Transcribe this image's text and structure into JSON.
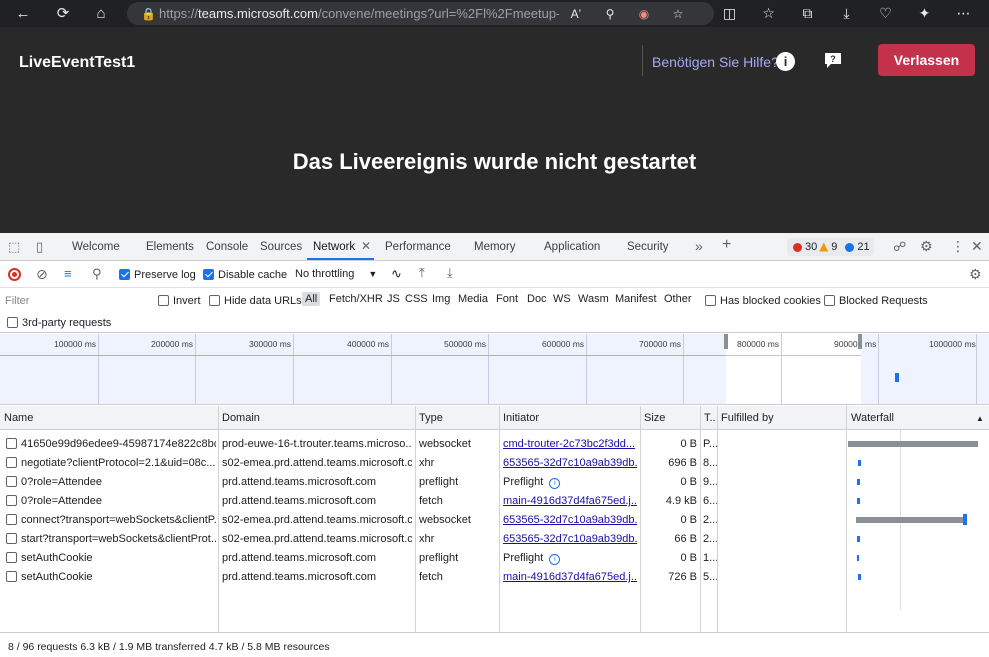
{
  "browser": {
    "url_prefix": "https://",
    "url_host": "teams.microsoft.com",
    "url_path": "/convene/meetings?url=%2Fl%2Fmeetup-j..."
  },
  "teams": {
    "event_title": "LiveEventTest1",
    "help_text": "Benötigen Sie Hilfe?",
    "leave_label": "Verlassen",
    "headline": "Das Liveereignis wurde nicht gestartet"
  },
  "devtools": {
    "tabs": [
      "Welcome",
      "Elements",
      "Console",
      "Sources",
      "Network",
      "Performance",
      "Memory",
      "Application",
      "Security"
    ],
    "active_tab": "Network",
    "errors": "30",
    "warnings": "9",
    "messages": "21",
    "preserve_log": "Preserve log",
    "disable_cache": "Disable cache",
    "throttling": "No throttling",
    "filter_placeholder": "Filter",
    "invert": "Invert",
    "hide_data_urls": "Hide data URLs",
    "types": [
      "All",
      "Fetch/XHR",
      "JS",
      "CSS",
      "Img",
      "Media",
      "Font",
      "Doc",
      "WS",
      "Wasm",
      "Manifest",
      "Other"
    ],
    "has_blocked_cookies": "Has blocked cookies",
    "blocked_requests": "Blocked Requests",
    "third_party": "3rd-party requests",
    "overview_ticks": [
      "100000 ms",
      "200000 ms",
      "300000 ms",
      "400000 ms",
      "500000 ms",
      "600000 ms",
      "700000 ms",
      "800000 ms",
      "90000",
      "ms",
      "1000000 ms"
    ],
    "columns": [
      "Name",
      "Domain",
      "Type",
      "Initiator",
      "Size",
      "T..",
      "Fulfilled by",
      "Waterfall"
    ],
    "rows": [
      {
        "name": "41650e99d96edee9-45987174e822c8bc...",
        "domain": "prod-euwe-16-t.trouter.teams.microso...",
        "type": "websocket",
        "initiator": "cmd-trouter-2c73bc2f3dd...",
        "initiator_link": true,
        "size": "0 B",
        "time": "P..."
      },
      {
        "name": "negotiate?clientProtocol=2.1&uid=08c...",
        "domain": "s02-emea.prd.attend.teams.microsoft.c...",
        "type": "xhr",
        "initiator": "653565-32d7c10a9ab39db...",
        "initiator_link": true,
        "size": "696 B",
        "time": "8..."
      },
      {
        "name": "0?role=Attendee",
        "domain": "prd.attend.teams.microsoft.com",
        "type": "preflight",
        "initiator": "Preflight",
        "initiator_link": false,
        "size": "0 B",
        "time": "9..."
      },
      {
        "name": "0?role=Attendee",
        "domain": "prd.attend.teams.microsoft.com",
        "type": "fetch",
        "initiator": "main-4916d37d4fa675ed.j...",
        "initiator_link": true,
        "size": "4.9 kB",
        "time": "6..."
      },
      {
        "name": "connect?transport=webSockets&clientP...",
        "domain": "s02-emea.prd.attend.teams.microsoft.c...",
        "type": "websocket",
        "initiator": "653565-32d7c10a9ab39db...",
        "initiator_link": true,
        "size": "0 B",
        "time": "2..."
      },
      {
        "name": "start?transport=webSockets&clientProt...",
        "domain": "s02-emea.prd.attend.teams.microsoft.c...",
        "type": "xhr",
        "initiator": "653565-32d7c10a9ab39db...",
        "initiator_link": true,
        "size": "66 B",
        "time": "2..."
      },
      {
        "name": "setAuthCookie",
        "domain": "prd.attend.teams.microsoft.com",
        "type": "preflight",
        "initiator": "Preflight",
        "initiator_link": false,
        "size": "0 B",
        "time": "1..."
      },
      {
        "name": "setAuthCookie",
        "domain": "prd.attend.teams.microsoft.com",
        "type": "fetch",
        "initiator": "main-4916d37d4fa675ed.j...",
        "initiator_link": true,
        "size": "726 B",
        "time": "5..."
      }
    ],
    "status_bar": "8 / 96 requests  6.3 kB / 1.9 MB transferred  4.7 kB / 5.8 MB resources"
  },
  "colors": {
    "teams_bg": "#292929",
    "leave_button": "#c4314b",
    "help_link": "#a6a9f5",
    "devtools_accent": "#1a73e8"
  }
}
